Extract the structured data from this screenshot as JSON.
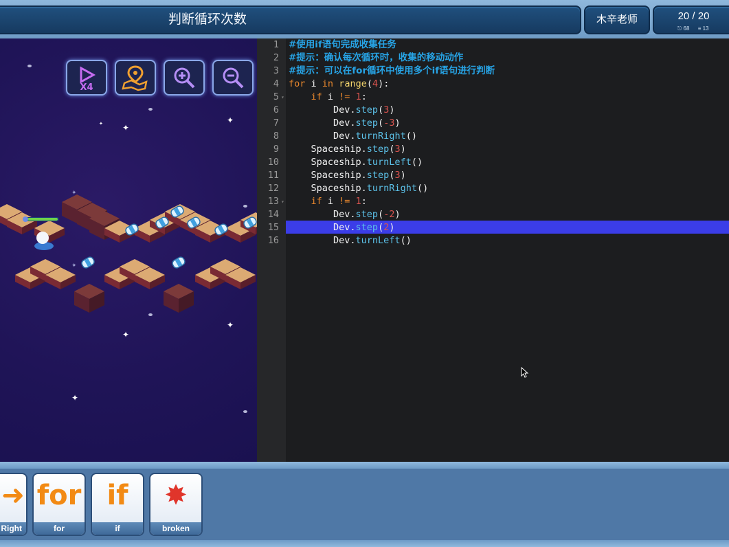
{
  "header": {
    "title": "判断循环次数",
    "teacher": "木辛老师",
    "progress": "20 / 20",
    "stats": [
      "⎋ 68",
      "≡ 13"
    ]
  },
  "game": {
    "tools": [
      {
        "name": "play-x4-icon",
        "label": "X4"
      },
      {
        "name": "map-pin-icon",
        "label": ""
      },
      {
        "name": "zoom-in-icon",
        "label": ""
      },
      {
        "name": "zoom-out-icon",
        "label": ""
      }
    ]
  },
  "editor": {
    "lines": [
      {
        "n": "1",
        "text": "#使用if语句完成收集任务"
      },
      {
        "n": "2",
        "text": "#提示：确认每次循环时，收集的移动动作"
      },
      {
        "n": "3",
        "text": "#提示：可以在for循环中使用多个if语句进行判断"
      },
      {
        "n": "4",
        "text": "for i in range(4):"
      },
      {
        "n": "5",
        "text": "    if i != 1:"
      },
      {
        "n": "6",
        "text": "        Dev.step(3)"
      },
      {
        "n": "7",
        "text": "        Dev.step(-3)"
      },
      {
        "n": "8",
        "text": "        Dev.turnRight()"
      },
      {
        "n": "9",
        "text": "    Spaceship.step(3)"
      },
      {
        "n": "10",
        "text": "    Spaceship.turnLeft()"
      },
      {
        "n": "11",
        "text": "    Spaceship.step(3)"
      },
      {
        "n": "12",
        "text": "    Spaceship.turnRight()"
      },
      {
        "n": "13",
        "text": "    if i != 1:"
      },
      {
        "n": "14",
        "text": "        Dev.step(-2)"
      },
      {
        "n": "15",
        "text": "        Dev.step(2)"
      },
      {
        "n": "16",
        "text": "        Dev.turnLeft()"
      }
    ],
    "highlighted_line": 15
  },
  "palette": {
    "cards": [
      {
        "label": "Right",
        "glyph": "➜"
      },
      {
        "label": "for",
        "glyph": "for"
      },
      {
        "label": "if",
        "glyph": "if"
      },
      {
        "label": "broken",
        "glyph": "✸"
      }
    ]
  }
}
